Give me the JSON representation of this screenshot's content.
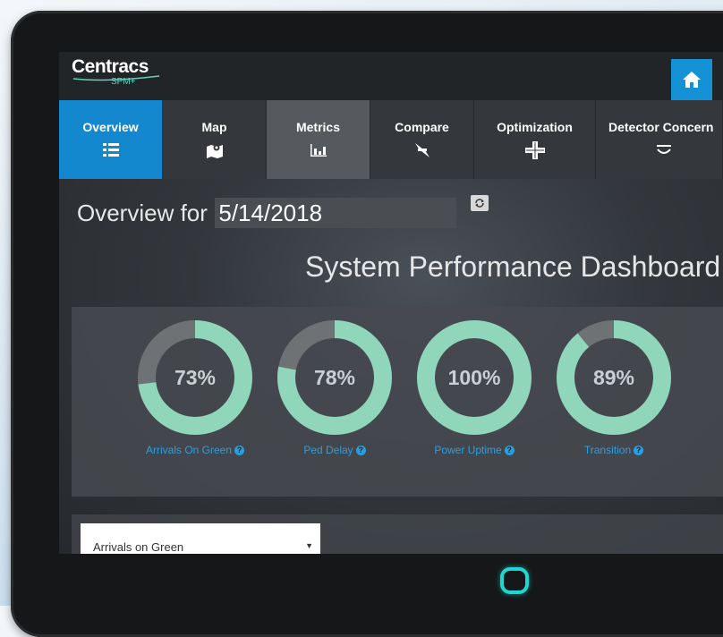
{
  "app": {
    "logo_name": "Centracs",
    "logo_sub": "SPM+"
  },
  "nav": [
    {
      "label": "Overview",
      "icon": "list-icon",
      "state": "active"
    },
    {
      "label": "Map",
      "icon": "map-pin-icon",
      "state": "normal"
    },
    {
      "label": "Metrics",
      "icon": "bar-chart-icon",
      "state": "highlighted"
    },
    {
      "label": "Compare",
      "icon": "compare-arrows-icon",
      "state": "normal"
    },
    {
      "label": "Optimization",
      "icon": "intersection-icon",
      "state": "normal"
    },
    {
      "label": "Detector Concern",
      "icon": "detector-icon",
      "state": "normal"
    }
  ],
  "overview": {
    "label": "Overview for",
    "date": "5/14/2018"
  },
  "dashboard": {
    "title": "System Performance Dashboard"
  },
  "gauges": [
    {
      "label": "Arrivals On Green",
      "value": 73,
      "display": "73%"
    },
    {
      "label": "Ped Delay",
      "value": 78,
      "display": "78%"
    },
    {
      "label": "Power Uptime",
      "value": 100,
      "display": "100%"
    },
    {
      "label": "Transition",
      "value": 89,
      "display": "89%"
    }
  ],
  "metric_select": {
    "selected": "Arrivals on Green"
  },
  "colors": {
    "accent": "#1488cf",
    "gauge_fill": "#8fd6bb",
    "gauge_track": "#6f7275",
    "link": "#2a9fe0"
  }
}
